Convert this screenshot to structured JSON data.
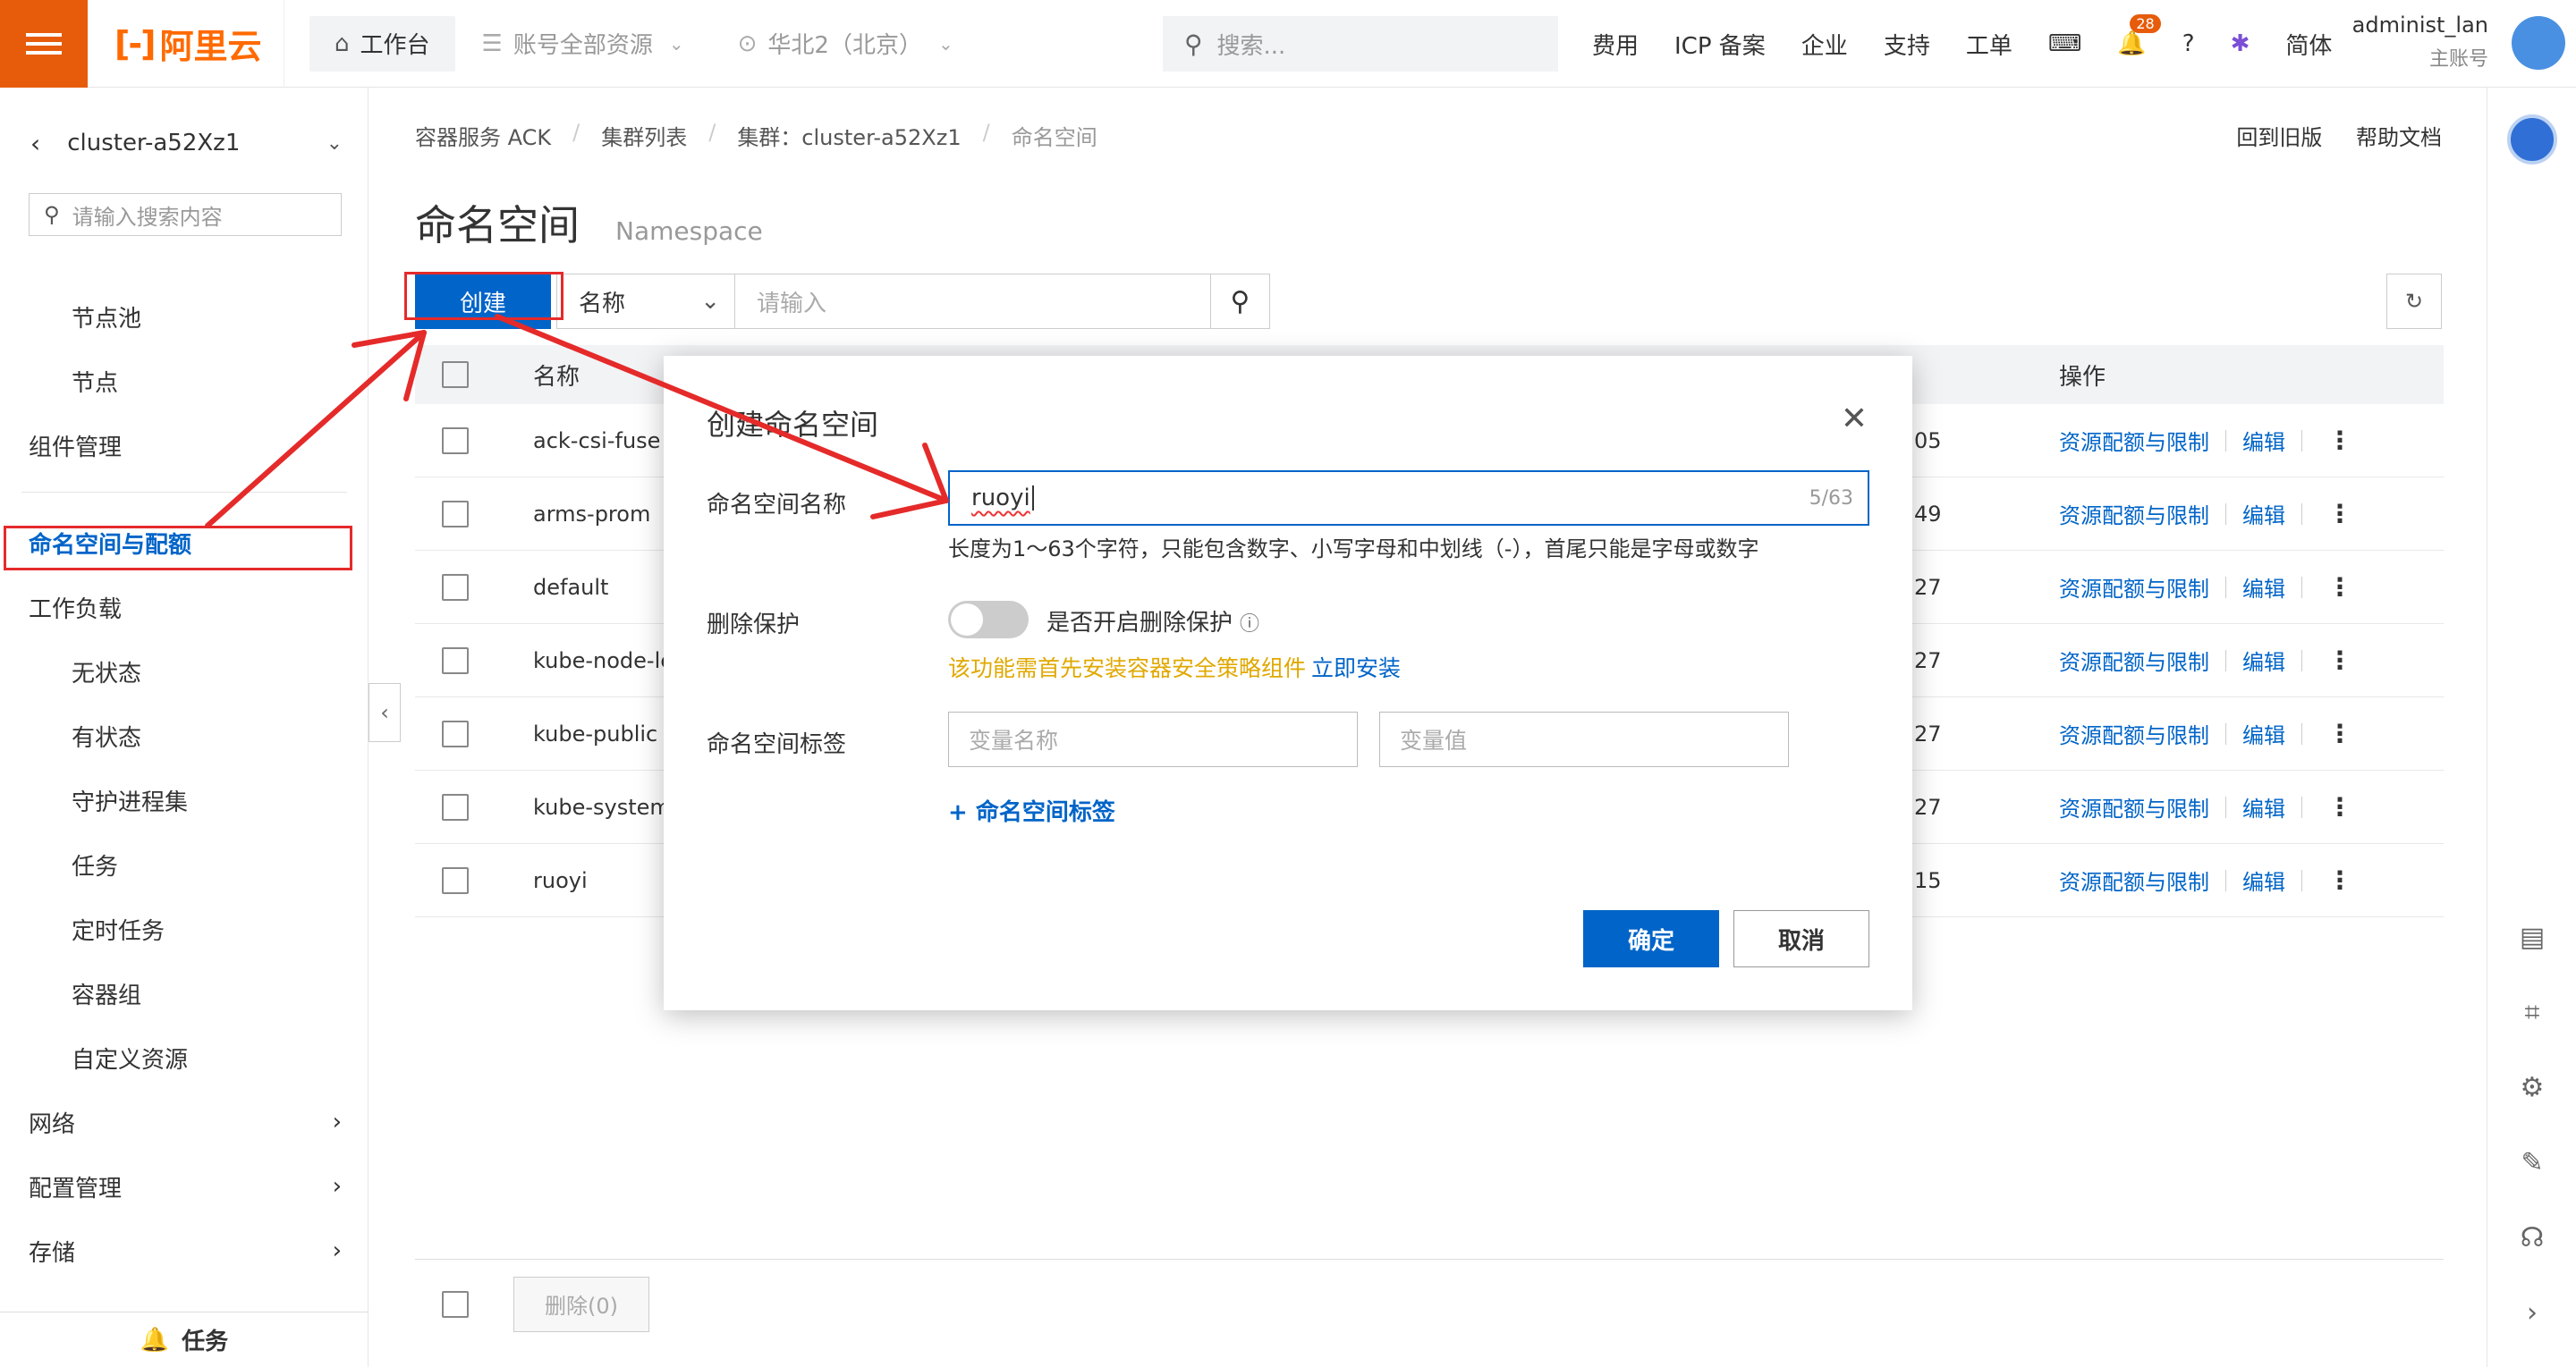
{
  "topbar": {
    "logo": "阿里云",
    "workbench": "工作台",
    "resources": "账号全部资源",
    "region": "华北2（北京）",
    "search_placeholder": "搜索...",
    "links": [
      "费用",
      "ICP 备案",
      "企业",
      "支持",
      "工单"
    ],
    "notif_count": "28",
    "language": "简体",
    "user_name": "administ_lan",
    "user_sub": "主账号"
  },
  "sidebar": {
    "cluster": "cluster-a52Xz1",
    "search_placeholder": "请输入搜索内容",
    "items": [
      {
        "label": "节点池",
        "level": 2
      },
      {
        "label": "节点",
        "level": 2
      },
      {
        "label": "组件管理",
        "level": 1
      },
      {
        "label": "命名空间与配额",
        "level": 1,
        "active": true
      },
      {
        "label": "工作负载",
        "level": 1
      },
      {
        "label": "无状态",
        "level": 2
      },
      {
        "label": "有状态",
        "level": 2
      },
      {
        "label": "守护进程集",
        "level": 2
      },
      {
        "label": "任务",
        "level": 2
      },
      {
        "label": "定时任务",
        "level": 2
      },
      {
        "label": "容器组",
        "level": 2
      },
      {
        "label": "自定义资源",
        "level": 2
      },
      {
        "label": "网络",
        "level": 1
      },
      {
        "label": "配置管理",
        "level": 1
      },
      {
        "label": "存储",
        "level": 1
      }
    ],
    "task_label": "任务"
  },
  "main": {
    "breadcrumb": [
      "容器服务 ACK",
      "集群列表",
      "集群：cluster-a52Xz1",
      "命名空间"
    ],
    "back_old": "回到旧版",
    "help_doc": "帮助文档",
    "title": "命名空间",
    "title_en": "Namespace",
    "create_button": "创建",
    "filter_field": "名称",
    "filter_placeholder": "请输入",
    "table": {
      "headers": [
        "名称",
        "操作"
      ],
      "rows": [
        {
          "name": "ack-csi-fuse",
          "time_tail": "05"
        },
        {
          "name": "arms-prom",
          "time_tail": "49"
        },
        {
          "name": "default",
          "time_tail": "27"
        },
        {
          "name": "kube-node-le",
          "time_tail": "27"
        },
        {
          "name": "kube-public",
          "time_tail": "27"
        },
        {
          "name": "kube-system",
          "time_tail": "27"
        },
        {
          "name": "ruoyi",
          "time_tail": "15"
        }
      ],
      "op_quota": "资源配额与限制",
      "op_edit": "编辑"
    },
    "delete_button": "删除(0)"
  },
  "modal": {
    "title": "创建命名空间",
    "ns_name_label": "命名空间名称",
    "ns_name_value": "ruoyi",
    "ns_name_count": "5/63",
    "ns_name_help": "长度为1～63个字符，只能包含数字、小写字母和中划线（-），首尾只能是字母或数字",
    "delete_protect_label": "删除保护",
    "delete_protect_toggle": "是否开启删除保护",
    "warn_text": "该功能需首先安装容器安全策略组件",
    "warn_link": "立即安装",
    "tags_label": "命名空间标签",
    "tag_key_placeholder": "变量名称",
    "tag_value_placeholder": "变量值",
    "add_tag": "+ 命名空间标签",
    "ok": "确定",
    "cancel": "取消"
  },
  "colors": {
    "primary": "#0064c8",
    "brand": "#e65c0b",
    "annotation": "#e52a2a",
    "warning": "#e0a800"
  }
}
